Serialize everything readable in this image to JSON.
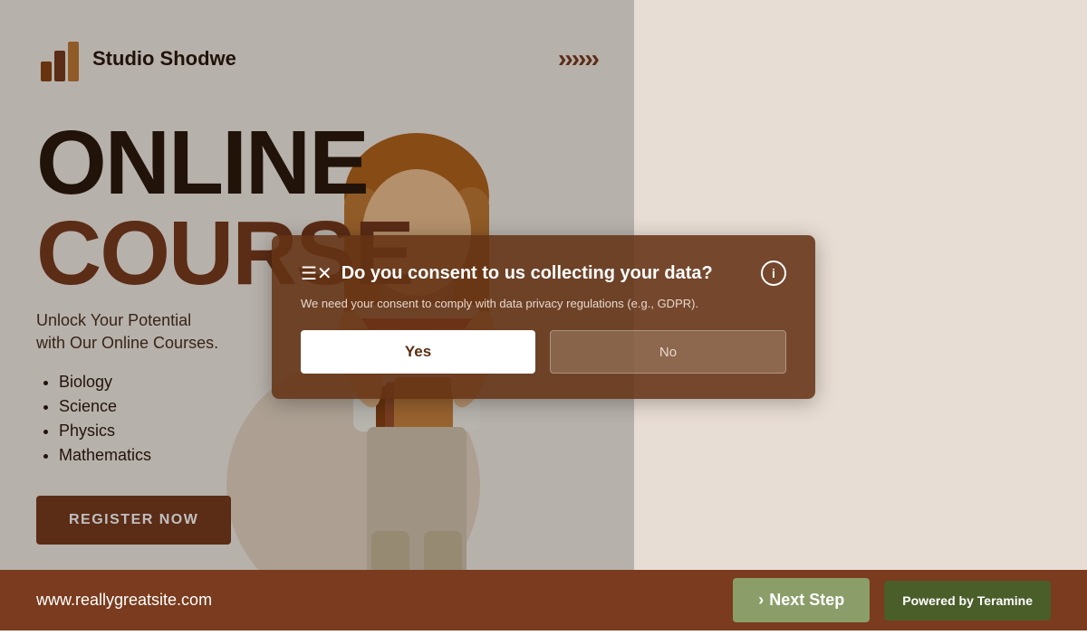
{
  "brand": {
    "logo_text": "Studio Shodwe",
    "chevrons": "›››››"
  },
  "hero": {
    "title_line1": "ONLINE",
    "title_line2": "COURSE",
    "subtitle_line1": "Unlock Your Potential",
    "subtitle_line2": "with Our Online Courses.",
    "courses": [
      "Biology",
      "Science",
      "Physics",
      "Mathematics"
    ],
    "register_btn": "REGISTER NOW"
  },
  "consent_modal": {
    "icon_left": "☰✕",
    "title": "Do you consent to us collecting your data?",
    "body": "We need your consent to comply with data privacy regulations (e.g., GDPR).",
    "btn_yes": "Yes",
    "btn_no": "No",
    "info_icon": "i"
  },
  "footer": {
    "url": "www.reallygreatsite.com",
    "next_step_label": "Next Step",
    "next_step_arrow": "›",
    "powered_label": "Powered by",
    "powered_brand": "Teramine"
  }
}
